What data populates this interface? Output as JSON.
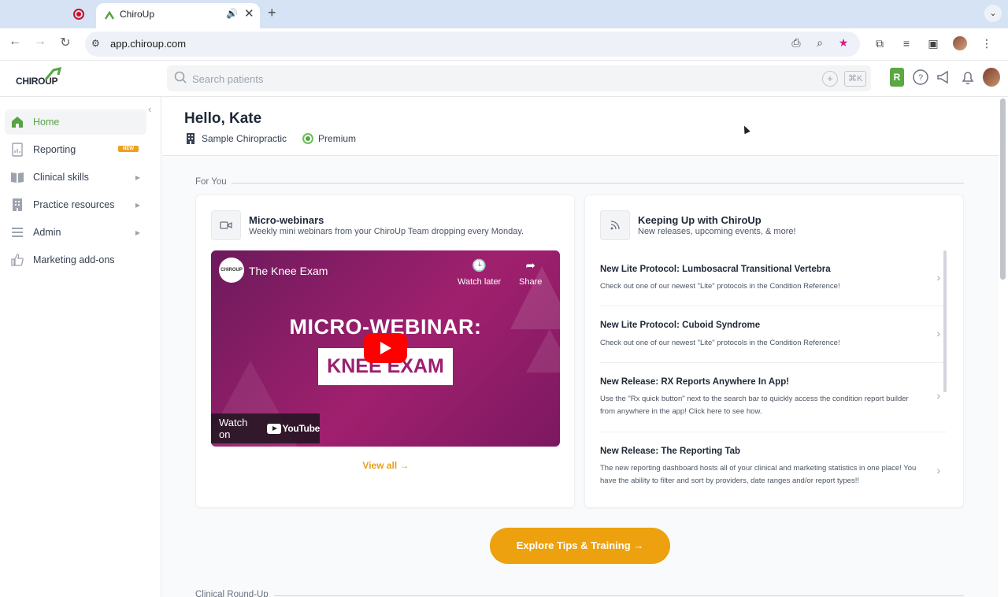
{
  "browser": {
    "active_tab_title": "ChiroUp",
    "new_tab_symbol": "+",
    "url": "app.chiroup.com"
  },
  "header": {
    "logo_text_chiro": "CHIRO",
    "logo_text_up": "UP",
    "search_placeholder": "Search patients",
    "search_plus": "+",
    "search_shortcut": "⌘K",
    "rx_label": "R"
  },
  "sidebar": {
    "items": [
      {
        "label": "Home",
        "icon": "home-icon"
      },
      {
        "label": "Reporting",
        "icon": "report-icon",
        "badge": "NEW"
      },
      {
        "label": "Clinical skills",
        "icon": "book-icon"
      },
      {
        "label": "Practice resources",
        "icon": "building-icon"
      },
      {
        "label": "Admin",
        "icon": "list-icon"
      },
      {
        "label": "Marketing add-ons",
        "icon": "thumbs-up-icon"
      }
    ]
  },
  "greeting": {
    "hello": "Hello, Kate",
    "clinic": "Sample Chiropractic",
    "plan": "Premium"
  },
  "for_you": {
    "section_label": "For You",
    "webinars": {
      "title": "Micro-webinars",
      "subtitle": "Weekly mini webinars from your ChiroUp Team dropping every Monday.",
      "video": {
        "channel": "CHIROUP",
        "title": "The Knee Exam",
        "watch_later": "Watch later",
        "share": "Share",
        "headline": "MICRO-WEBINAR:",
        "box_text": "KNEE EXAM",
        "watch_on": "Watch on",
        "youtube": "YouTube"
      },
      "view_all": "View all →"
    },
    "news": {
      "title": "Keeping Up with ChiroUp",
      "subtitle": "New releases, upcoming events, & more!",
      "items": [
        {
          "title": "New Lite Protocol: Lumbosacral Transitional Vertebra",
          "desc": "Check out one of our newest \"Lite\" protocols in the Condition Reference!"
        },
        {
          "title": "New Lite Protocol: Cuboid Syndrome",
          "desc": "Check out one of our newest \"Lite\" protocols in the Condition Reference!"
        },
        {
          "title": "New Release: RX Reports Anywhere In App!",
          "desc": "Use the \"Rx quick button\" next to the search bar to quickly access the condition report builder from anywhere in the app! Click here to see how."
        },
        {
          "title": "New Release: The Reporting Tab",
          "desc": "The new reporting dashboard hosts all of your clinical and marketing statistics in one place! You have the ability to filter and sort by providers, date ranges and/or report types!!"
        }
      ]
    }
  },
  "explore_button": "Explore Tips & Training →",
  "clinical_roundup_label": "Clinical Round-Up",
  "colors": {
    "brand_green": "#58a343",
    "accent_orange": "#eda10e",
    "video_magenta": "#a0206e"
  }
}
